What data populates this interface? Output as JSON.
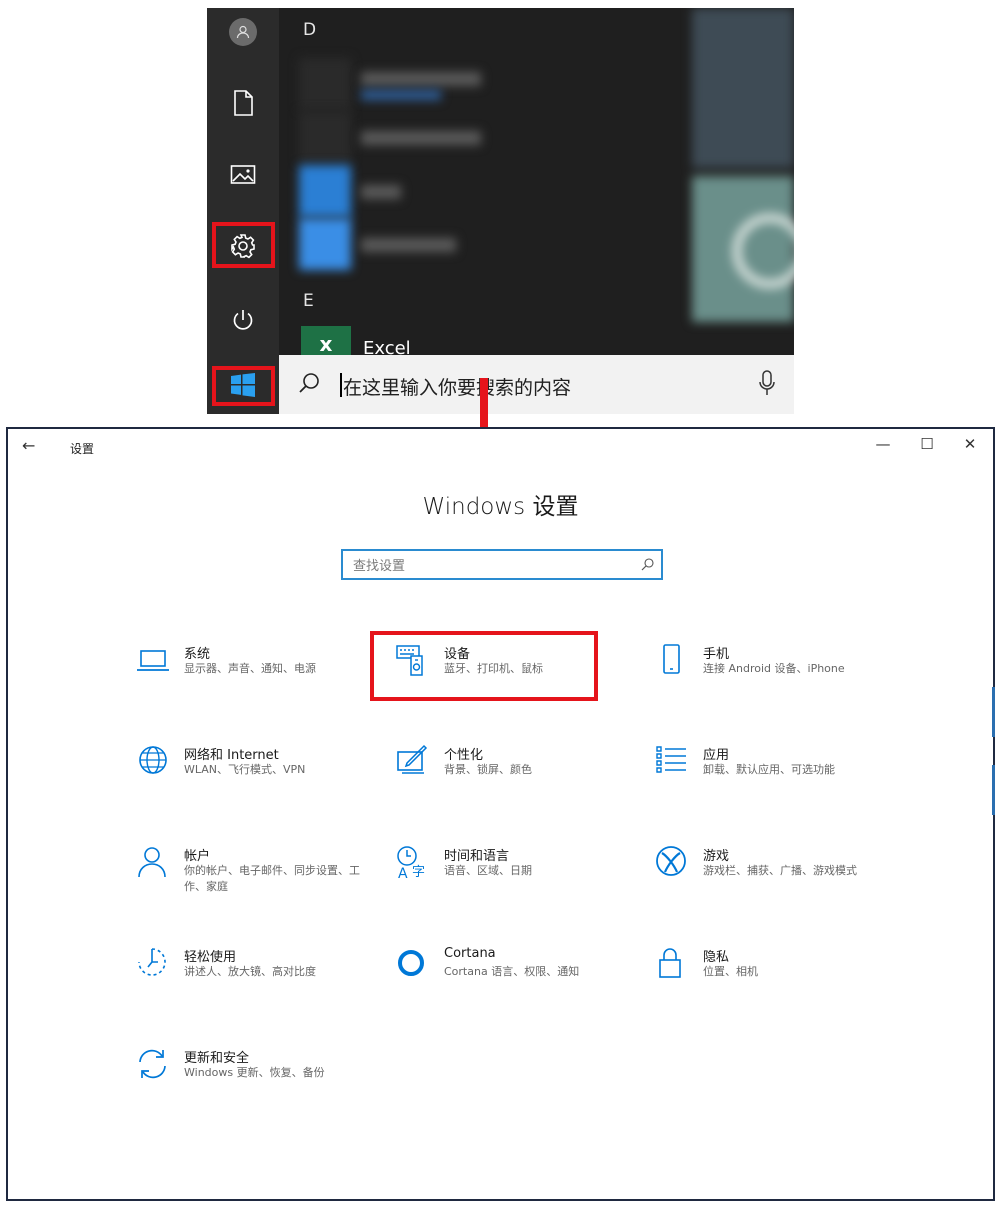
{
  "start_menu": {
    "section_d": "D",
    "section_e": "E",
    "excel_label": "Excel",
    "excel_tile_text": "x",
    "search_placeholder": "在这里输入你要搜索的内容"
  },
  "window": {
    "title": "设置",
    "back_glyph": "←",
    "minimize_glyph": "—",
    "maximize_glyph": "☐",
    "close_glyph": "✕",
    "heading": "Windows 设置",
    "search_placeholder": "查找设置"
  },
  "categories": [
    {
      "title": "系统",
      "desc": "显示器、声音、通知、电源",
      "icon": "laptop-icon"
    },
    {
      "title": "设备",
      "desc": "蓝牙、打印机、鼠标",
      "icon": "devices-icon"
    },
    {
      "title": "手机",
      "desc": "连接 Android 设备、iPhone",
      "icon": "phone-icon"
    },
    {
      "title": "网络和 Internet",
      "desc": "WLAN、飞行模式、VPN",
      "icon": "globe-icon"
    },
    {
      "title": "个性化",
      "desc": "背景、锁屏、颜色",
      "icon": "paint-icon"
    },
    {
      "title": "应用",
      "desc": "卸载、默认应用、可选功能",
      "icon": "apps-list-icon"
    },
    {
      "title": "帐户",
      "desc": "你的帐户、电子邮件、同步设置、工作、家庭",
      "icon": "person-icon"
    },
    {
      "title": "时间和语言",
      "desc": "语音、区域、日期",
      "icon": "time-language-icon"
    },
    {
      "title": "游戏",
      "desc": "游戏栏、捕获、广播、游戏模式",
      "icon": "xbox-icon"
    },
    {
      "title": "轻松使用",
      "desc": "讲述人、放大镜、高对比度",
      "icon": "ease-of-access-icon"
    },
    {
      "title": "Cortana",
      "desc": "Cortana 语言、权限、通知",
      "icon": "cortana-icon"
    },
    {
      "title": "隐私",
      "desc": "位置、相机",
      "icon": "lock-icon"
    },
    {
      "title": "更新和安全",
      "desc": "Windows 更新、恢复、备份",
      "icon": "update-icon"
    }
  ],
  "colors": {
    "accent": "#0078d7",
    "highlight": "#e5141b",
    "start_bg": "#1f1f1f"
  }
}
